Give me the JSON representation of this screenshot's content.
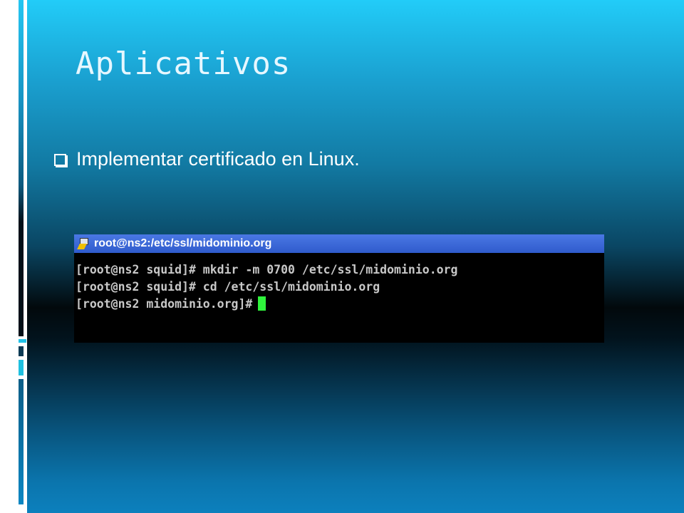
{
  "slide": {
    "title": "Aplicativos",
    "bullet": "Implementar certificado en Linux.",
    "accent_color": "#22ccf8"
  },
  "terminal": {
    "window_title": "root@ns2:/etc/ssl/midominio.org",
    "icon": "putty-icon",
    "lines": [
      "[root@ns2 squid]# mkdir -m 0700 /etc/ssl/midominio.org",
      "[root@ns2 squid]# cd /etc/ssl/midominio.org",
      "[root@ns2 midominio.org]#"
    ],
    "cursor_color": "#2ff33c"
  }
}
